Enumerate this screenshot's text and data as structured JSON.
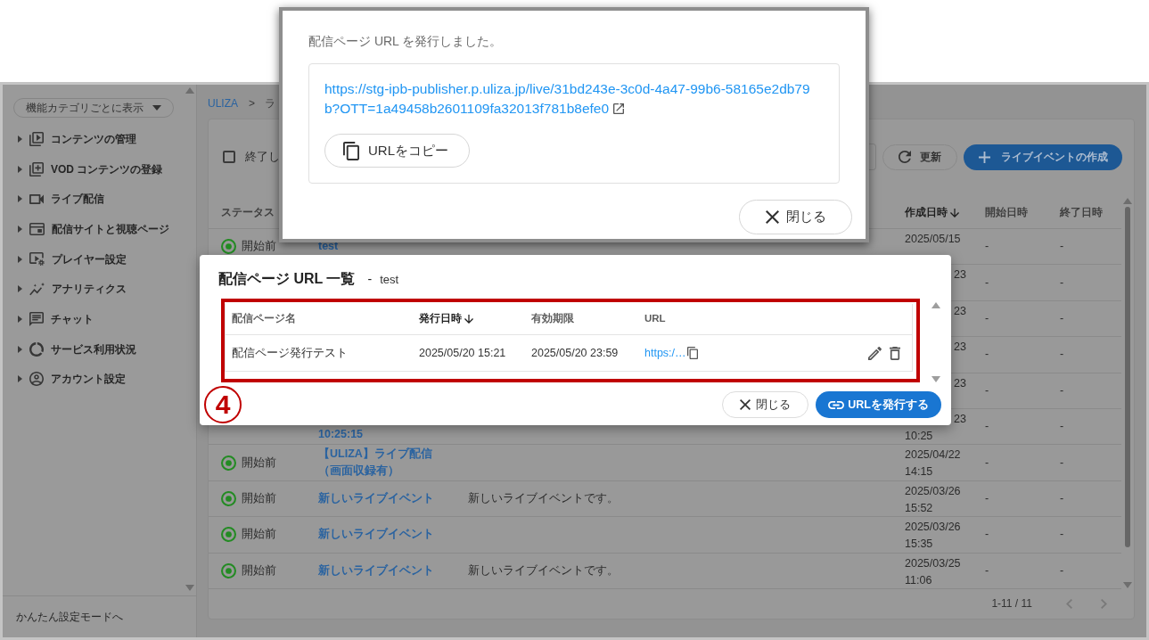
{
  "sidebar": {
    "dropdown": "機能カテゴリごとに表示",
    "items": [
      {
        "label": "コンテンツの管理",
        "expanded": false
      },
      {
        "label": "VOD コンテンツの登録",
        "expanded": false
      },
      {
        "label": "ライブ配信",
        "expanded": false
      },
      {
        "label": "配信サイトと視聴ページ",
        "expanded": false
      },
      {
        "label": "プレイヤー設定",
        "expanded": false
      },
      {
        "label": "アナリティクス",
        "expanded": false
      },
      {
        "label": "チャット",
        "expanded": false
      },
      {
        "label": "サービス利用状況",
        "expanded": false
      },
      {
        "label": "アカウント設定",
        "expanded": false
      }
    ],
    "footer_link": "かんたん設定モードへ"
  },
  "breadcrumb": {
    "items": [
      "ULIZA",
      "ラ"
    ],
    "separator": ">"
  },
  "toolbar": {
    "checkbox": {
      "label": "終了し",
      "checked": false
    },
    "refresh_button": "更新",
    "create_button": "ライブイベントの作成"
  },
  "table": {
    "columns": [
      {
        "label": "ステータス",
        "sorted": false
      },
      {
        "label": "作成日時",
        "sorted": true
      },
      {
        "label": "開始日時",
        "sorted": false
      },
      {
        "label": "終了日時",
        "sorted": false
      }
    ],
    "rows": [
      {
        "covered": false,
        "status": "開始前",
        "name": "test",
        "created": [
          "2025/05/15"
        ],
        "start": "-",
        "end": "-"
      },
      {
        "covered": true,
        "created": [
          "23"
        ],
        "start": "-",
        "end": "-"
      },
      {
        "covered": true,
        "created": [
          "23"
        ],
        "start": "-",
        "end": "-"
      },
      {
        "covered": true,
        "created": [
          "23"
        ],
        "start": "-",
        "end": "-"
      },
      {
        "covered": true,
        "created": [
          "23"
        ],
        "start": "-",
        "end": "-"
      },
      {
        "covered": true,
        "name": "10:25:15",
        "created": [
          "23",
          "10:25"
        ],
        "start": "-",
        "end": "-"
      },
      {
        "covered": false,
        "status": "開始前",
        "name": "【ULIZA】ライブ配信（画面収録有）",
        "created": [
          "2025/04/22",
          "14:15"
        ],
        "start": "-",
        "end": "-"
      },
      {
        "covered": false,
        "status": "開始前",
        "name": "新しいライブイベント",
        "description": "新しいライブイベントです。",
        "created": [
          "2025/03/26",
          "15:52"
        ],
        "start": "-",
        "end": "-"
      },
      {
        "covered": false,
        "status": "開始前",
        "name": "新しいライブイベント",
        "created": [
          "2025/03/26",
          "15:35"
        ],
        "start": "-",
        "end": "-"
      },
      {
        "covered": false,
        "status": "開始前",
        "name": "新しいライブイベント",
        "description": "新しいライブイベントです。",
        "created": [
          "2025/03/25",
          "11:06"
        ],
        "start": "-",
        "end": "-"
      }
    ],
    "pagination": "1-11 / 11"
  },
  "issued_dialog": {
    "message": "配信ページ URL を発行しました。",
    "url": "https://stg-ipb-publisher.p.uliza.jp/live/31bd243e-3c0d-4a47-99b6-58165e2db79b?OTT=1a49458b2601109fa32013f781b8efe0",
    "copy_button": "URLをコピー",
    "close_button": "閉じる"
  },
  "url_list_dialog": {
    "title": "配信ページ URL 一覧",
    "separator": "-",
    "subtitle": "test",
    "columns": [
      {
        "label": "配信ページ名",
        "sorted": false
      },
      {
        "label": "発行日時",
        "sorted": true
      },
      {
        "label": "有効期限",
        "sorted": false
      },
      {
        "label": "URL",
        "sorted": false
      }
    ],
    "rows": [
      {
        "name": "配信ページ発行テスト",
        "issued": "2025/05/20 15:21",
        "expires": "2025/05/20 23:59",
        "url": "https:/…"
      }
    ],
    "close_button": "閉じる",
    "issue_button": "URLを発行する"
  },
  "annotation": {
    "label": "4"
  }
}
